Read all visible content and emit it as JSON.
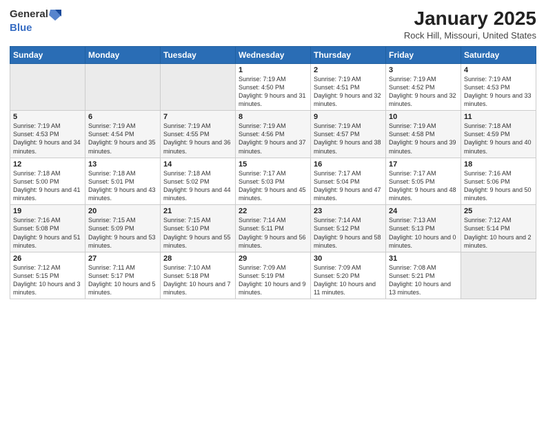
{
  "logo": {
    "general": "General",
    "blue": "Blue"
  },
  "calendar": {
    "title": "January 2025",
    "subtitle": "Rock Hill, Missouri, United States"
  },
  "weekdays": [
    "Sunday",
    "Monday",
    "Tuesday",
    "Wednesday",
    "Thursday",
    "Friday",
    "Saturday"
  ],
  "weeks": [
    [
      {
        "day": "",
        "info": ""
      },
      {
        "day": "",
        "info": ""
      },
      {
        "day": "",
        "info": ""
      },
      {
        "day": "1",
        "info": "Sunrise: 7:19 AM\nSunset: 4:50 PM\nDaylight: 9 hours and 31 minutes."
      },
      {
        "day": "2",
        "info": "Sunrise: 7:19 AM\nSunset: 4:51 PM\nDaylight: 9 hours and 32 minutes."
      },
      {
        "day": "3",
        "info": "Sunrise: 7:19 AM\nSunset: 4:52 PM\nDaylight: 9 hours and 32 minutes."
      },
      {
        "day": "4",
        "info": "Sunrise: 7:19 AM\nSunset: 4:53 PM\nDaylight: 9 hours and 33 minutes."
      }
    ],
    [
      {
        "day": "5",
        "info": "Sunrise: 7:19 AM\nSunset: 4:53 PM\nDaylight: 9 hours and 34 minutes."
      },
      {
        "day": "6",
        "info": "Sunrise: 7:19 AM\nSunset: 4:54 PM\nDaylight: 9 hours and 35 minutes."
      },
      {
        "day": "7",
        "info": "Sunrise: 7:19 AM\nSunset: 4:55 PM\nDaylight: 9 hours and 36 minutes."
      },
      {
        "day": "8",
        "info": "Sunrise: 7:19 AM\nSunset: 4:56 PM\nDaylight: 9 hours and 37 minutes."
      },
      {
        "day": "9",
        "info": "Sunrise: 7:19 AM\nSunset: 4:57 PM\nDaylight: 9 hours and 38 minutes."
      },
      {
        "day": "10",
        "info": "Sunrise: 7:19 AM\nSunset: 4:58 PM\nDaylight: 9 hours and 39 minutes."
      },
      {
        "day": "11",
        "info": "Sunrise: 7:18 AM\nSunset: 4:59 PM\nDaylight: 9 hours and 40 minutes."
      }
    ],
    [
      {
        "day": "12",
        "info": "Sunrise: 7:18 AM\nSunset: 5:00 PM\nDaylight: 9 hours and 41 minutes."
      },
      {
        "day": "13",
        "info": "Sunrise: 7:18 AM\nSunset: 5:01 PM\nDaylight: 9 hours and 43 minutes."
      },
      {
        "day": "14",
        "info": "Sunrise: 7:18 AM\nSunset: 5:02 PM\nDaylight: 9 hours and 44 minutes."
      },
      {
        "day": "15",
        "info": "Sunrise: 7:17 AM\nSunset: 5:03 PM\nDaylight: 9 hours and 45 minutes."
      },
      {
        "day": "16",
        "info": "Sunrise: 7:17 AM\nSunset: 5:04 PM\nDaylight: 9 hours and 47 minutes."
      },
      {
        "day": "17",
        "info": "Sunrise: 7:17 AM\nSunset: 5:05 PM\nDaylight: 9 hours and 48 minutes."
      },
      {
        "day": "18",
        "info": "Sunrise: 7:16 AM\nSunset: 5:06 PM\nDaylight: 9 hours and 50 minutes."
      }
    ],
    [
      {
        "day": "19",
        "info": "Sunrise: 7:16 AM\nSunset: 5:08 PM\nDaylight: 9 hours and 51 minutes."
      },
      {
        "day": "20",
        "info": "Sunrise: 7:15 AM\nSunset: 5:09 PM\nDaylight: 9 hours and 53 minutes."
      },
      {
        "day": "21",
        "info": "Sunrise: 7:15 AM\nSunset: 5:10 PM\nDaylight: 9 hours and 55 minutes."
      },
      {
        "day": "22",
        "info": "Sunrise: 7:14 AM\nSunset: 5:11 PM\nDaylight: 9 hours and 56 minutes."
      },
      {
        "day": "23",
        "info": "Sunrise: 7:14 AM\nSunset: 5:12 PM\nDaylight: 9 hours and 58 minutes."
      },
      {
        "day": "24",
        "info": "Sunrise: 7:13 AM\nSunset: 5:13 PM\nDaylight: 10 hours and 0 minutes."
      },
      {
        "day": "25",
        "info": "Sunrise: 7:12 AM\nSunset: 5:14 PM\nDaylight: 10 hours and 2 minutes."
      }
    ],
    [
      {
        "day": "26",
        "info": "Sunrise: 7:12 AM\nSunset: 5:15 PM\nDaylight: 10 hours and 3 minutes."
      },
      {
        "day": "27",
        "info": "Sunrise: 7:11 AM\nSunset: 5:17 PM\nDaylight: 10 hours and 5 minutes."
      },
      {
        "day": "28",
        "info": "Sunrise: 7:10 AM\nSunset: 5:18 PM\nDaylight: 10 hours and 7 minutes."
      },
      {
        "day": "29",
        "info": "Sunrise: 7:09 AM\nSunset: 5:19 PM\nDaylight: 10 hours and 9 minutes."
      },
      {
        "day": "30",
        "info": "Sunrise: 7:09 AM\nSunset: 5:20 PM\nDaylight: 10 hours and 11 minutes."
      },
      {
        "day": "31",
        "info": "Sunrise: 7:08 AM\nSunset: 5:21 PM\nDaylight: 10 hours and 13 minutes."
      },
      {
        "day": "",
        "info": ""
      }
    ]
  ]
}
